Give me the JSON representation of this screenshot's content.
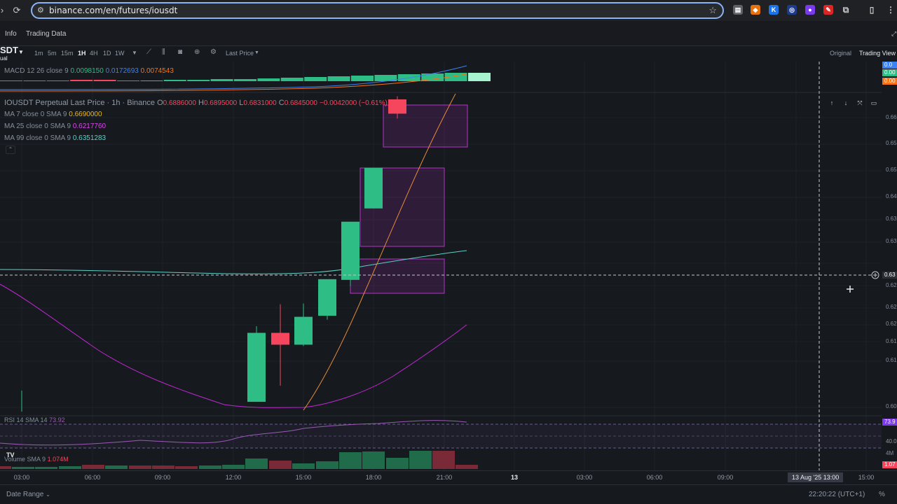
{
  "browser": {
    "url": "binance.com/en/futures/iousdt",
    "ext_icons": [
      "reader-mode-icon",
      "fox-extension-icon",
      "k-extension-icon",
      "wallet-extension-icon",
      "purple-extension-icon",
      "red-extension-icon",
      "puzzle-extensions-icon",
      "sidebar-icon",
      "menu-dots-icon"
    ]
  },
  "subnav": {
    "info": "Info",
    "trading_data": "Trading Data"
  },
  "toolbar": {
    "symbol": "SDT",
    "symbol_sub": "ual",
    "timeframes": [
      "1m",
      "5m",
      "15m",
      "1H",
      "4H",
      "1D",
      "1W"
    ],
    "active_timeframe": "1H",
    "price_type": "Last Price",
    "view_original": "Original",
    "view_tradingview": "Trading View"
  },
  "macd": {
    "label": "MACD 12 26 close 9",
    "v1": "0.0098150",
    "v2": "0.0172693",
    "v3": "0.0074543",
    "tag1": "0.0",
    "tag2": "0.00",
    "tag3": "0.00"
  },
  "main_legend": {
    "title": "IOUSDT Perpetual Last Price · 1h · Binance",
    "o_label": "O",
    "o": "0.6886000",
    "h_label": "H",
    "h": "0.6895000",
    "l_label": "L",
    "l": "0.6831000",
    "c_label": "C",
    "c": "0.6845000",
    "chg": "−0.0042000 (−0.61%)",
    "ma7_label": "MA 7 close 0 SMA 9",
    "ma7": "0.6690000",
    "ma25_label": "MA 25 close 0 SMA 9",
    "ma25": "0.6217760",
    "ma99_label": "MA 99 close 0 SMA 9",
    "ma99": "0.6351283"
  },
  "rsi": {
    "label": "RSI 14 SMA 14",
    "value": "73.92",
    "tag": "73.9",
    "level": "40.0"
  },
  "volume": {
    "label": "Volume SMA 9",
    "value": "1.074M",
    "tag": "1.07",
    "scale": "4M"
  },
  "price_scale": [
    "0.66",
    "0.65",
    "0.65",
    "0.64",
    "0.63",
    "0.63",
    "0.62",
    "0.62",
    "0.62",
    "0.61",
    "0.61",
    "0.60"
  ],
  "crosshair_price": "0.63",
  "time_axis": [
    "03:00",
    "06:00",
    "09:00",
    "12:00",
    "15:00",
    "18:00",
    "21:00",
    "13",
    "03:00",
    "06:00",
    "09:00",
    "15:00"
  ],
  "crosshair_time": "13 Aug '25  13:00",
  "footer": {
    "date_range": "Date Range",
    "clock": "22:20:22 (UTC+1)",
    "pct": "%"
  },
  "colors": {
    "up": "#2ebd85",
    "down": "#f6465d",
    "ma7": "#f0b90b",
    "ma25": "#c026d3",
    "ma99": "#5fd0c8",
    "rsi": "#9b59b6"
  },
  "candles": [
    {
      "o": 0.6018,
      "h": 0.6235,
      "l": 0.6018,
      "c": 0.6216
    },
    {
      "o": 0.6216,
      "h": 0.6298,
      "l": 0.6064,
      "c": 0.6182
    },
    {
      "o": 0.6182,
      "h": 0.63,
      "l": 0.6178,
      "c": 0.6262
    },
    {
      "o": 0.6265,
      "h": 0.6346,
      "l": 0.6254,
      "c": 0.637
    },
    {
      "o": 0.6368,
      "h": 0.6532,
      "l": 0.635,
      "c": 0.6535
    },
    {
      "o": 0.6573,
      "h": 0.664,
      "l": 0.6573,
      "c": 0.669
    },
    {
      "o": 0.6886,
      "h": 0.6895,
      "l": 0.6831,
      "c": 0.6845
    }
  ]
}
